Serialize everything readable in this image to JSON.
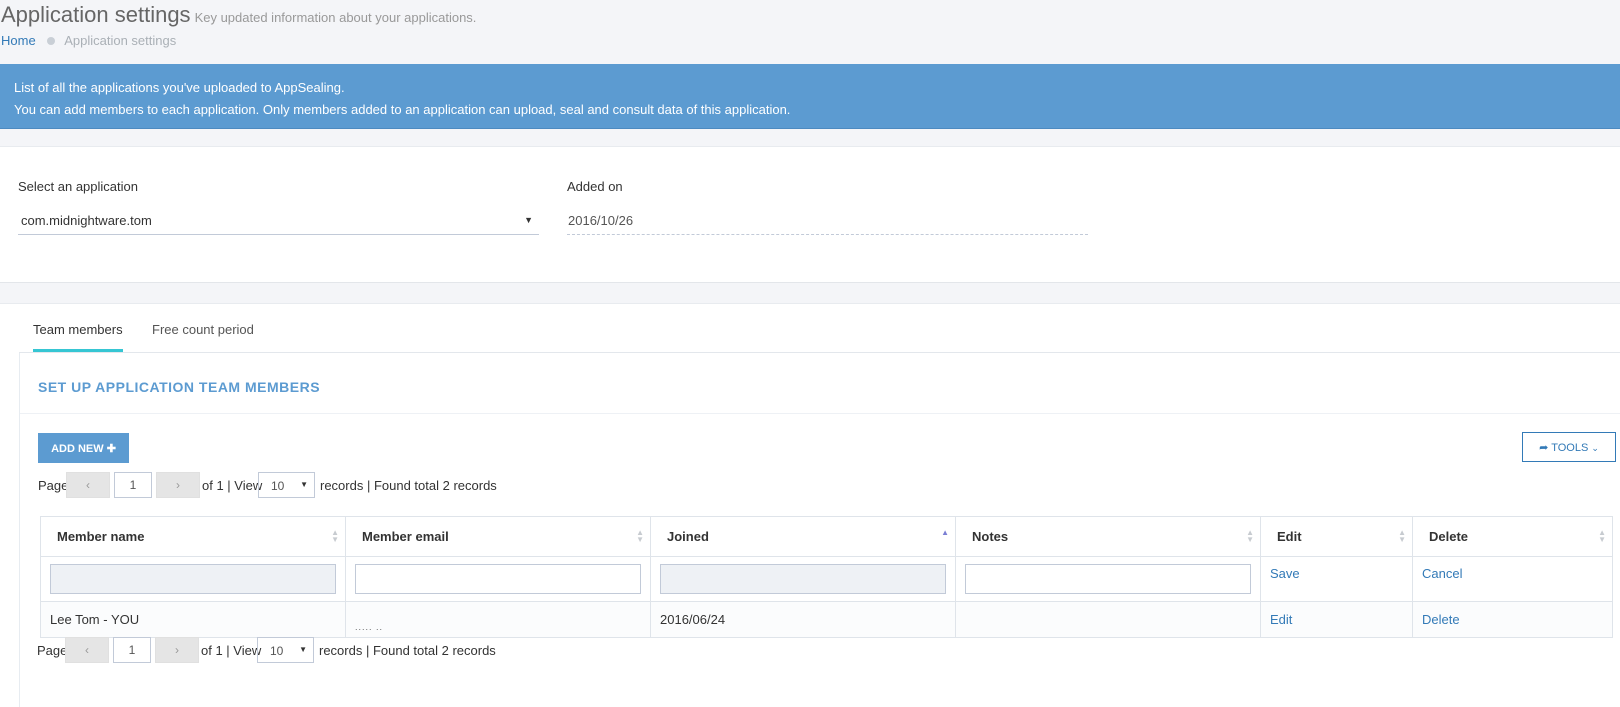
{
  "header": {
    "title": "Application settings",
    "subtitle": "Key updated information about your applications.",
    "breadcrumb": {
      "home": "Home",
      "current": "Application settings"
    }
  },
  "notice": {
    "line1": "List of all the applications you've uploaded to AppSealing.",
    "line2": "You can add members to each application. Only members added to an application can upload, seal and consult data of this application."
  },
  "app_panel": {
    "select_label": "Select an application",
    "selected_app": "com.midnightware.tom",
    "added_label": "Added on",
    "added_value": "2016/10/26"
  },
  "tabs": [
    {
      "label": "Team members",
      "active": true
    },
    {
      "label": "Free count period",
      "active": false
    }
  ],
  "section": {
    "title": "SET UP APPLICATION TEAM MEMBERS"
  },
  "toolbar": {
    "add_label": "ADD NEW",
    "add_icon": "plus-icon",
    "tools_label": "TOOLS",
    "tools_icon": "share-icon"
  },
  "pager": {
    "page_label": "Page",
    "prev": "‹",
    "next": "›",
    "page_value": "1",
    "of_label": "of 1 | View",
    "view_value": "10",
    "records_label": "records | Found total 2 records"
  },
  "table": {
    "columns": [
      "Member name",
      "Member email",
      "Joined",
      "Notes",
      "Edit",
      "Delete"
    ],
    "filter_row": {
      "save": "Save",
      "cancel": "Cancel"
    },
    "rows": [
      {
        "name": "Lee Tom - YOU",
        "email": "..... ..",
        "joined": "2016/06/24",
        "notes": "",
        "edit": "Edit",
        "delete": "Delete"
      }
    ]
  },
  "colors": {
    "accent": "#5c9bd1",
    "tab_active": "#36c6d3",
    "link": "#337ab7"
  }
}
